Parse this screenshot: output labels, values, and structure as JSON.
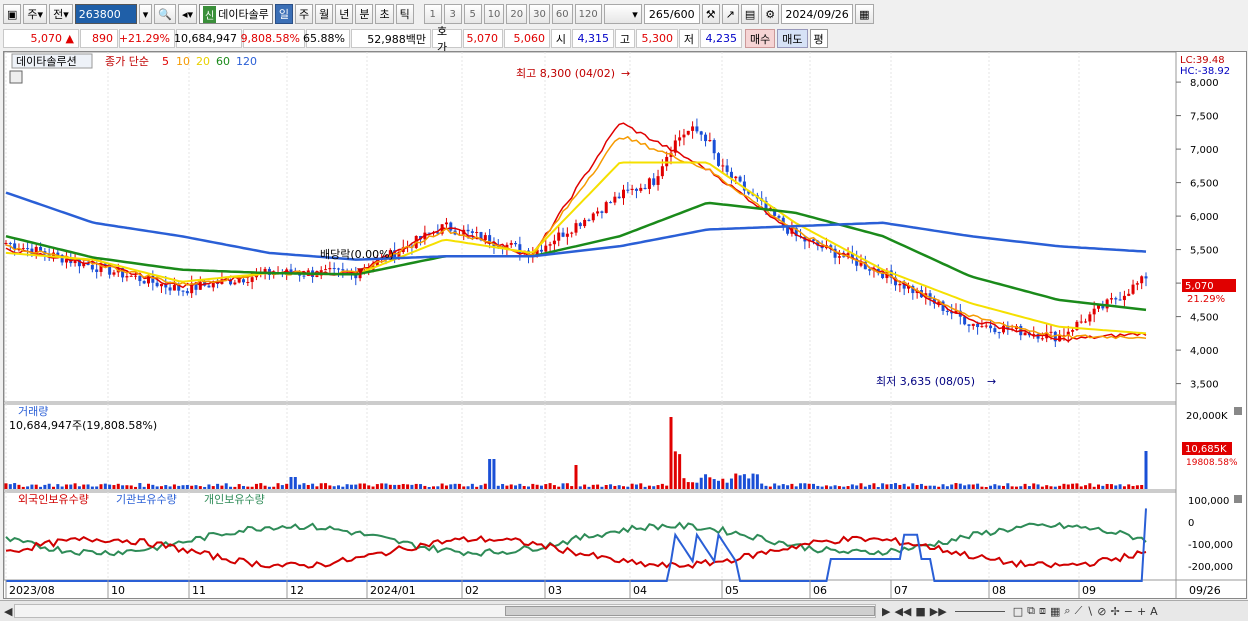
{
  "toolbar": {
    "period_unit": "주",
    "prev_label": "전",
    "code": "263800",
    "market_badge": "신",
    "stock_name": "데이타솔루",
    "periods": [
      "일",
      "주",
      "월",
      "년",
      "분",
      "초",
      "틱"
    ],
    "minutes": [
      "1",
      "3",
      "5",
      "10",
      "20",
      "30",
      "60",
      "120"
    ],
    "count": "265",
    "count_total": "/600",
    "date": "2024/09/26"
  },
  "quote": {
    "price": "5,070",
    "up_arrow": "▲",
    "change": "890",
    "change_pct": "+21.29%",
    "volume": "10,684,947",
    "volume_pct": "9,808.58%",
    "turnover_pct": "65.88%",
    "amount": "52,988백만",
    "hoga_label": "호가",
    "hoga_ask": "5,070",
    "hoga_bid": "5,060",
    "open_label": "시",
    "open": "4,315",
    "high_label": "고",
    "high": "5,300",
    "low_label": "저",
    "low": "4,235",
    "buy": "매수",
    "sell": "매도",
    "avg": "평"
  },
  "legend": {
    "stock": "데이타솔루션",
    "price_type": "종가 단순",
    "ma": [
      "5",
      "10",
      "20",
      "60",
      "120"
    ],
    "ma_colors": [
      "#e00000",
      "#f59a00",
      "#f5e000",
      "#1a8a1a",
      "#2a5fd6"
    ]
  },
  "annotations": {
    "high": "최고 8,300 (04/02)",
    "low": "최저 3,635 (08/05)",
    "dividend": "배당락(0.00%)",
    "lc": "LC:39.48",
    "hc": "HC:-38.92",
    "price_tag": "5,070",
    "pct_tag": "21.29%"
  },
  "price_axis": [
    "8,000",
    "7,500",
    "7,000",
    "6,500",
    "6,000",
    "5,500",
    "5,000",
    "4,500",
    "4,000",
    "3,500"
  ],
  "volume_panel": {
    "title": "거래량",
    "info": "10,684,947주(19,808.58%)",
    "axis": "20,000K",
    "tag": "10,685K",
    "tag2": "19808.58%"
  },
  "holdings_panel": {
    "series": [
      "외국인보유수량",
      "기관보유수량",
      "개인보유수량"
    ],
    "colors": [
      "#d00000",
      "#2a5fd6",
      "#2e8b57"
    ],
    "axis": [
      "100,000",
      "0",
      "-100,000",
      "-200,000"
    ]
  },
  "x_axis": [
    "2023/08",
    "10",
    "11",
    "12",
    "2024/01",
    "02",
    "03",
    "04",
    "05",
    "06",
    "07",
    "08",
    "09",
    "09/26"
  ],
  "chart_data": {
    "type": "line",
    "title": "",
    "price_ylim": [
      3300,
      8300
    ],
    "series": [
      {
        "name": "데이타솔루션",
        "type": "candlestick",
        "x": [
          "2023/08",
          "10",
          "11",
          "12",
          "2024/01",
          "02",
          "03",
          "04",
          "05",
          "06",
          "07",
          "08",
          "09",
          "09/26"
        ],
        "close": [
          5600,
          5250,
          4900,
          5150,
          5150,
          5850,
          5450,
          6300,
          6900,
          5700,
          5150,
          4400,
          4200,
          5070
        ]
      },
      {
        "name": "5",
        "values": [
          5500,
          5300,
          4950,
          5150,
          5150,
          5850,
          5400,
          7400,
          6700,
          5750,
          5150,
          4450,
          4150,
          4250
        ]
      },
      {
        "name": "10",
        "values": [
          5550,
          5300,
          4980,
          5150,
          5150,
          5800,
          5420,
          7200,
          6700,
          5780,
          5150,
          4500,
          4200,
          4200
        ]
      },
      {
        "name": "20",
        "values": [
          5450,
          5350,
          5020,
          5150,
          5130,
          5650,
          5450,
          6800,
          6800,
          5900,
          5200,
          4700,
          4350,
          4250
        ]
      },
      {
        "name": "60",
        "values": [
          5700,
          5380,
          5200,
          5150,
          5130,
          5400,
          5400,
          5700,
          6200,
          6050,
          5700,
          5100,
          4750,
          4600
        ]
      },
      {
        "name": "120",
        "values": [
          6350,
          5900,
          5700,
          5450,
          5350,
          5400,
          5400,
          5550,
          5800,
          5850,
          5900,
          5700,
          5550,
          5470
        ]
      }
    ]
  }
}
